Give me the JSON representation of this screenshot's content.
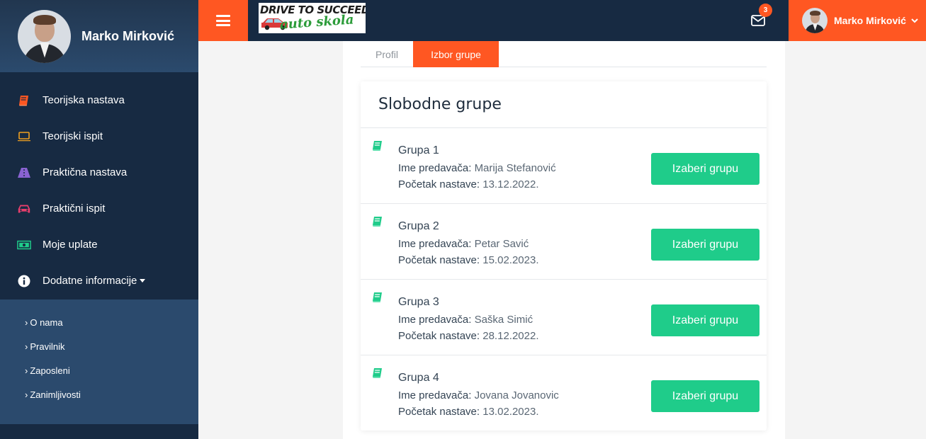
{
  "sidebar": {
    "profile_name": "Marko Mirković",
    "menu": [
      {
        "label": "Teorijska nastava",
        "icon": "book-icon",
        "color": "#ff5722"
      },
      {
        "label": "Teorijski ispit",
        "icon": "laptop-icon",
        "color": "#f0a020"
      },
      {
        "label": "Praktična nastava",
        "icon": "road-icon",
        "color": "#8a63d2"
      },
      {
        "label": "Praktični ispit",
        "icon": "car-icon",
        "color": "#e83e6c"
      },
      {
        "label": "Moje uplate",
        "icon": "money-icon",
        "color": "#1fcc8a"
      },
      {
        "label": "Dodatne informacije",
        "icon": "info-icon",
        "color": "#ffffff"
      }
    ],
    "submenu": [
      {
        "label": "O nama"
      },
      {
        "label": "Pravilnik"
      },
      {
        "label": "Zaposleni"
      },
      {
        "label": "Zanimljivosti"
      }
    ]
  },
  "topbar": {
    "logo_line1": "DRIVE TO SUCCEED",
    "logo_line2": "auto skola",
    "mail_count": "3",
    "user_name": "Marko Mirković"
  },
  "tabs": [
    {
      "label": "Profil",
      "active": false
    },
    {
      "label": "Izbor grupe",
      "active": true
    }
  ],
  "card": {
    "title": "Slobodne grupe",
    "teacher_label": "Ime predavača:",
    "start_label": "Početak nastave:",
    "button_label": "Izaberi grupu",
    "groups": [
      {
        "name": "Grupa 1",
        "teacher": "Marija Stefanović",
        "start": "13.12.2022."
      },
      {
        "name": "Grupa 2",
        "teacher": "Petar Savić",
        "start": "15.02.2023."
      },
      {
        "name": "Grupa 3",
        "teacher": "Saška Simić",
        "start": "28.12.2022."
      },
      {
        "name": "Grupa 4",
        "teacher": "Jovana Jovanovic",
        "start": "13.02.2023."
      }
    ]
  },
  "colors": {
    "accent": "#ff5722",
    "sidebar_bg": "#172a42",
    "sidebar_highlight": "#2b4a6d",
    "button_green": "#1fcc8a"
  }
}
